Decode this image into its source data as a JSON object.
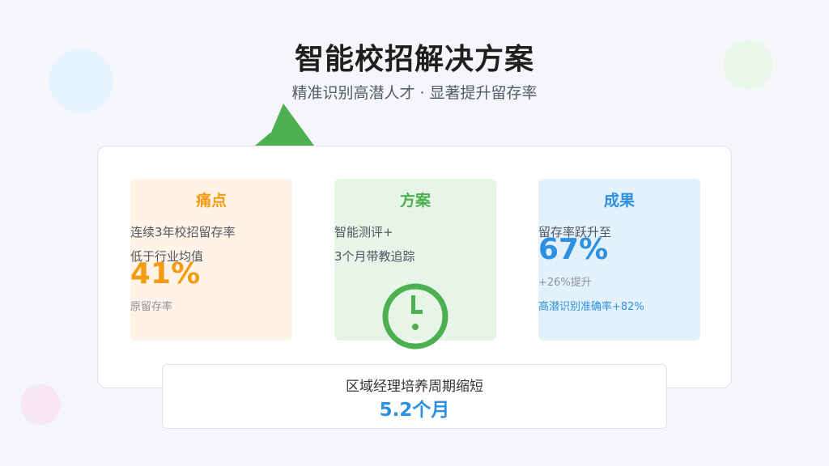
{
  "header": {
    "title": "智能校招解决方案",
    "subtitle": "精准识别高潜人才 · 显著提升留存率"
  },
  "colors": {
    "pain": "#f39c12",
    "plan": "#4caf50",
    "result": "#2e90e0"
  },
  "cards": {
    "pain": {
      "title": "痛点",
      "line1": "连续3年校招留存率",
      "line2": "低于行业均值",
      "value": "41%",
      "note": "原留存率"
    },
    "plan": {
      "title": "方案",
      "line1": "智能测评+",
      "line2": "3个月带教追踪",
      "icon": "clock-icon"
    },
    "result": {
      "title": "成果",
      "line1": "留存率跃升至",
      "value": "67%",
      "note1": "+26%提升",
      "note2": "高潜识别准确率+82%"
    }
  },
  "footer": {
    "label": "区域经理培养周期缩短",
    "value": "5.2个月"
  },
  "decorations": {
    "arrow_icon": "arrow-up-icon"
  }
}
